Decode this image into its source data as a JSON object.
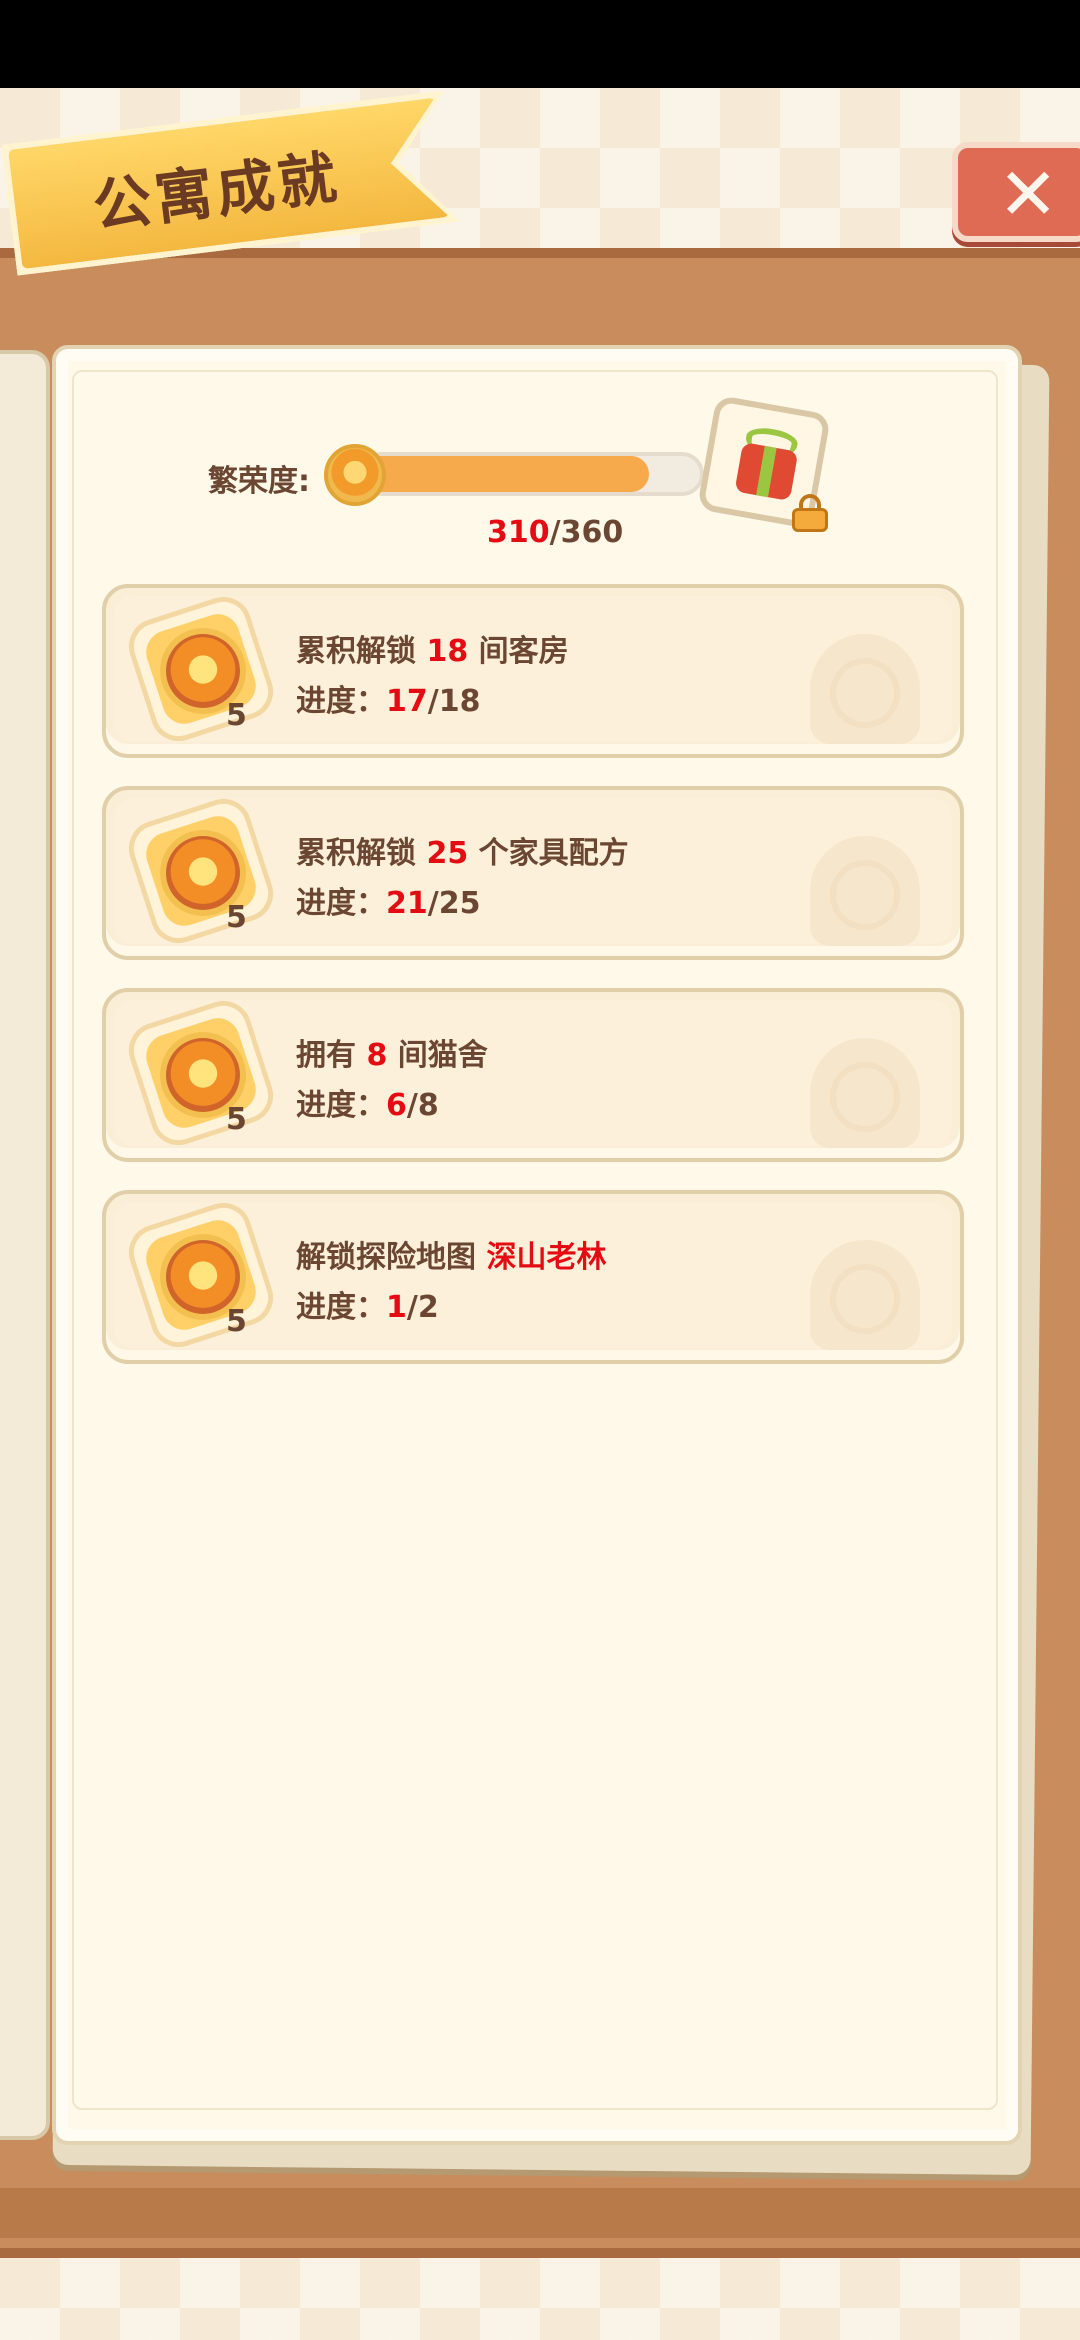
{
  "header": {
    "title": "公寓成就",
    "close_label": "✕"
  },
  "prosperity": {
    "label": "繁荣度:",
    "current": "310",
    "total": "/360",
    "fill_fraction": 0.86
  },
  "achievements": [
    {
      "title_pre": "累积解锁 ",
      "title_value": "18",
      "title_post": " 间客房",
      "progress_label": "进度：",
      "progress_current": "17",
      "progress_total": "/18",
      "reward_count": "5"
    },
    {
      "title_pre": "累积解锁 ",
      "title_value": "25",
      "title_post": " 个家具配方",
      "progress_label": "进度：",
      "progress_current": "21",
      "progress_total": "/25",
      "reward_count": "5"
    },
    {
      "title_pre": "拥有 ",
      "title_value": "8",
      "title_post": " 间猫舍",
      "progress_label": "进度：",
      "progress_current": "6",
      "progress_total": "/8",
      "reward_count": "5"
    },
    {
      "title_pre": "解锁探险地图 ",
      "title_value": "深山老林",
      "title_post": "",
      "progress_label": "进度：",
      "progress_current": "1",
      "progress_total": "/2",
      "reward_count": "5"
    }
  ],
  "colors": {
    "highlight": "#e50b12",
    "text": "#6b4632",
    "bar_fill": "#f6aa4c",
    "shelf": "#c98c5c"
  },
  "icons": {
    "close": "close-icon",
    "gift": "gift-icon",
    "lock": "lock-icon",
    "medal": "medal-icon"
  }
}
